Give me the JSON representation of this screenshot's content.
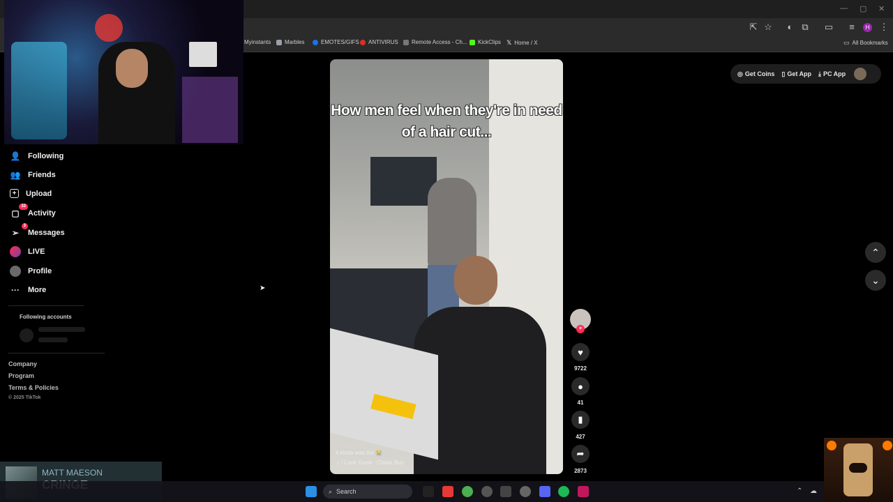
{
  "browser": {
    "bookmarks": [
      {
        "label": "Myinstants",
        "color": "#555555"
      },
      {
        "label": "Marbles",
        "color": "#9aa0a6"
      },
      {
        "label": "EMOTES/GIFS",
        "color": "#1a73e8"
      },
      {
        "label": "ANTIVIRUS",
        "color": "#d93025"
      },
      {
        "label": "Remote Access - Ch...",
        "color": "#777777"
      },
      {
        "label": "KickClips",
        "color": "#53fc18"
      },
      {
        "label": "Home / X",
        "color": "#ffffff"
      }
    ],
    "all_bookmarks": "All Bookmarks",
    "profile_initial": "H"
  },
  "sidebar": {
    "items": [
      {
        "label": "Following",
        "icon": "person-follow-icon"
      },
      {
        "label": "Friends",
        "icon": "friends-icon"
      },
      {
        "label": "Upload",
        "icon": "upload-icon"
      },
      {
        "label": "Activity",
        "icon": "activity-icon",
        "badge": "33"
      },
      {
        "label": "Messages",
        "icon": "messages-icon",
        "badge": "3"
      },
      {
        "label": "LIVE",
        "icon": "live-icon"
      },
      {
        "label": "Profile",
        "icon": "profile-avatar-icon"
      },
      {
        "label": "More",
        "icon": "more-icon"
      }
    ],
    "following_accounts": "Following accounts",
    "footer": {
      "company": "Company",
      "program": "Program",
      "terms": "Terms & Policies",
      "copyright": "© 2025 TikTok"
    }
  },
  "top_actions": {
    "get_coins": "Get Coins",
    "get_app": "Get App",
    "pc_app": "PC App"
  },
  "video": {
    "overlay_text": "How men feel when they're in need of a hair cut...",
    "sound": "♫ I Look Good - Chalie Boy",
    "caption_hint": "it kinda was tho 😭"
  },
  "rail": {
    "likes": "9722",
    "comments": "41",
    "saves": "427",
    "shares": "2873"
  },
  "now_playing": {
    "artist": "MATT MAESON",
    "title": "CRINGE"
  },
  "taskbar": {
    "search_placeholder": "Search"
  },
  "colors": {
    "accent": "#fe2c55",
    "background": "#000000"
  }
}
